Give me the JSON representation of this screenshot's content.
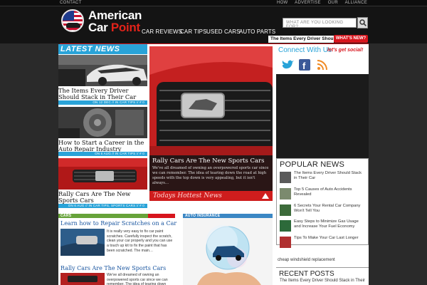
{
  "topbar": {
    "contact": "CONTACT",
    "links": "HOW   ADVERTISE   OUR ALLIANCE"
  },
  "header": {
    "logo_line1": "American",
    "logo_line2a": "Car ",
    "logo_line2b": "Point",
    "search_placeholder": "WHAT ARE YOU LOOKING FOR?"
  },
  "nav": {
    "items": [
      "CAR REVIEWS",
      "CAR TIPS",
      "USED CARS",
      "AUTO PARTS"
    ]
  },
  "ticker": {
    "headline": "The Items Every Driver Should Stack in Their Car",
    "badge": "WHAT'S NEW?"
  },
  "latest": {
    "header": "LATEST NEWS",
    "items": [
      {
        "title": "The Items Every Driver Should Stack in Their Car",
        "meta": "ON 12 DEC  //  IN CAR TIPS  //  # 0"
      },
      {
        "title": "How to Start a Career in the Auto Repair Industry",
        "meta": "ON 6 AUG  //  IN CAR TIPS  //  # 0"
      },
      {
        "title": "Rally Cars Are The New Sports Cars",
        "meta": "ON 6 AUG  //  IN CAR TIPS, SPORTS CARS  //  # 0"
      }
    ]
  },
  "feature": {
    "title": "Rally Cars Are The New Sports Cars",
    "body": "We've all dreamed of owning an overpowered sports car since we can remember. The idea of tearing down the road at high speeds with the top down is very appealing, but it isn't always…",
    "hottest": "Todays Hottest News"
  },
  "connect": {
    "title": "Connect With Us",
    "tagline": "let's get social!"
  },
  "popular": {
    "header": "POPULAR NEWS",
    "items": [
      "The Items Every Driver Should Stack in Their Car",
      "Top 5 Causes of Auto Accidents Revealed",
      "6 Secrets Your Rental Car Company Won't Tell You",
      "Easy Steps to Minimize Gas Usage and Increase Your Fuel Economy",
      "Tips To Make Your Car Last Longer"
    ]
  },
  "sidebar": {
    "windshield": "cheap windshield replacement",
    "recent_header": "RECENT POSTS",
    "recent_item": "The Items Every Driver Should Stack in Their"
  },
  "cars_section": {
    "header": "CARS",
    "articles": [
      {
        "title": "Learn how to Repair Scratches on a Car",
        "body": "It is really very easy to fix car paint scratches. Carefully inspect the scratch, clean your car properly and you can use a touch up kit to fix the paint that has been scratched. The main…"
      },
      {
        "title": "Rally Cars Are The New Sports Cars",
        "body": "We've all dreamed of owning an overpowered sports car since we can remember. The idea of tearing down"
      }
    ]
  },
  "insurance_section": {
    "header": "AUTO INSURANCE"
  },
  "colors": {
    "accent_blue": "#29a3d8",
    "accent_red": "#d7151d",
    "cars_green": "#67a33a"
  }
}
